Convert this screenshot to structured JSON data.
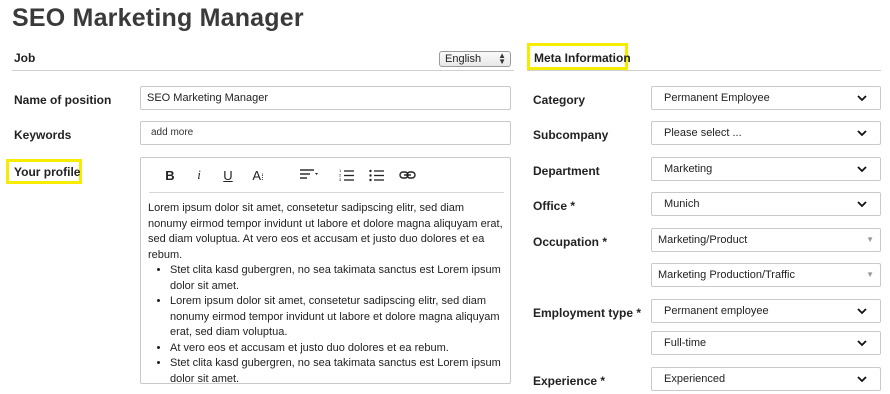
{
  "page": {
    "title": "SEO Marketing Manager"
  },
  "job": {
    "heading": "Job",
    "language": "English",
    "name_label": "Name of position",
    "name_value": "SEO Marketing Manager",
    "keywords_label": "Keywords",
    "keywords_placeholder": "add more",
    "profile_label": "Your profile"
  },
  "editor": {
    "toolbar": {
      "bold": "B",
      "italic": "I",
      "underline": "U",
      "text_size": "A",
      "text_size_sub": "I"
    },
    "paragraph": "Lorem ipsum dolor sit amet, consetetur sadipscing elitr, sed diam nonumy eirmod tempor invidunt ut labore et dolore magna aliquyam erat, sed diam voluptua. At vero eos et accusam et justo duo dolores et ea rebum.",
    "bullets": [
      "Stet clita kasd gubergren, no sea takimata sanctus est Lorem ipsum dolor sit amet.",
      "Lorem ipsum dolor sit amet, consetetur sadipscing elitr, sed diam nonumy eirmod tempor invidunt ut labore et dolore magna aliquyam erat, sed diam voluptua.",
      "At vero eos et accusam et justo duo dolores et ea rebum.",
      "Stet clita kasd gubergren, no sea takimata sanctus est Lorem ipsum dolor sit amet."
    ]
  },
  "meta": {
    "heading": "Meta Information",
    "fields": {
      "category": {
        "label": "Category",
        "value": "Permanent Employee"
      },
      "subcompany": {
        "label": "Subcompany",
        "value": "Please select ..."
      },
      "department": {
        "label": "Department",
        "value": "Marketing"
      },
      "office": {
        "label": "Office *",
        "value": "Munich"
      },
      "occupation": {
        "label": "Occupation *",
        "value": "Marketing/Product",
        "value2": "Marketing Production/Traffic"
      },
      "employment": {
        "label": "Employment type *",
        "value": "Permanent employee",
        "value2": "Full-time"
      },
      "experience": {
        "label": "Experience *",
        "value": "Experienced"
      }
    }
  },
  "colors": {
    "highlight": "#f5ec00",
    "border": "#c9c9c9"
  }
}
